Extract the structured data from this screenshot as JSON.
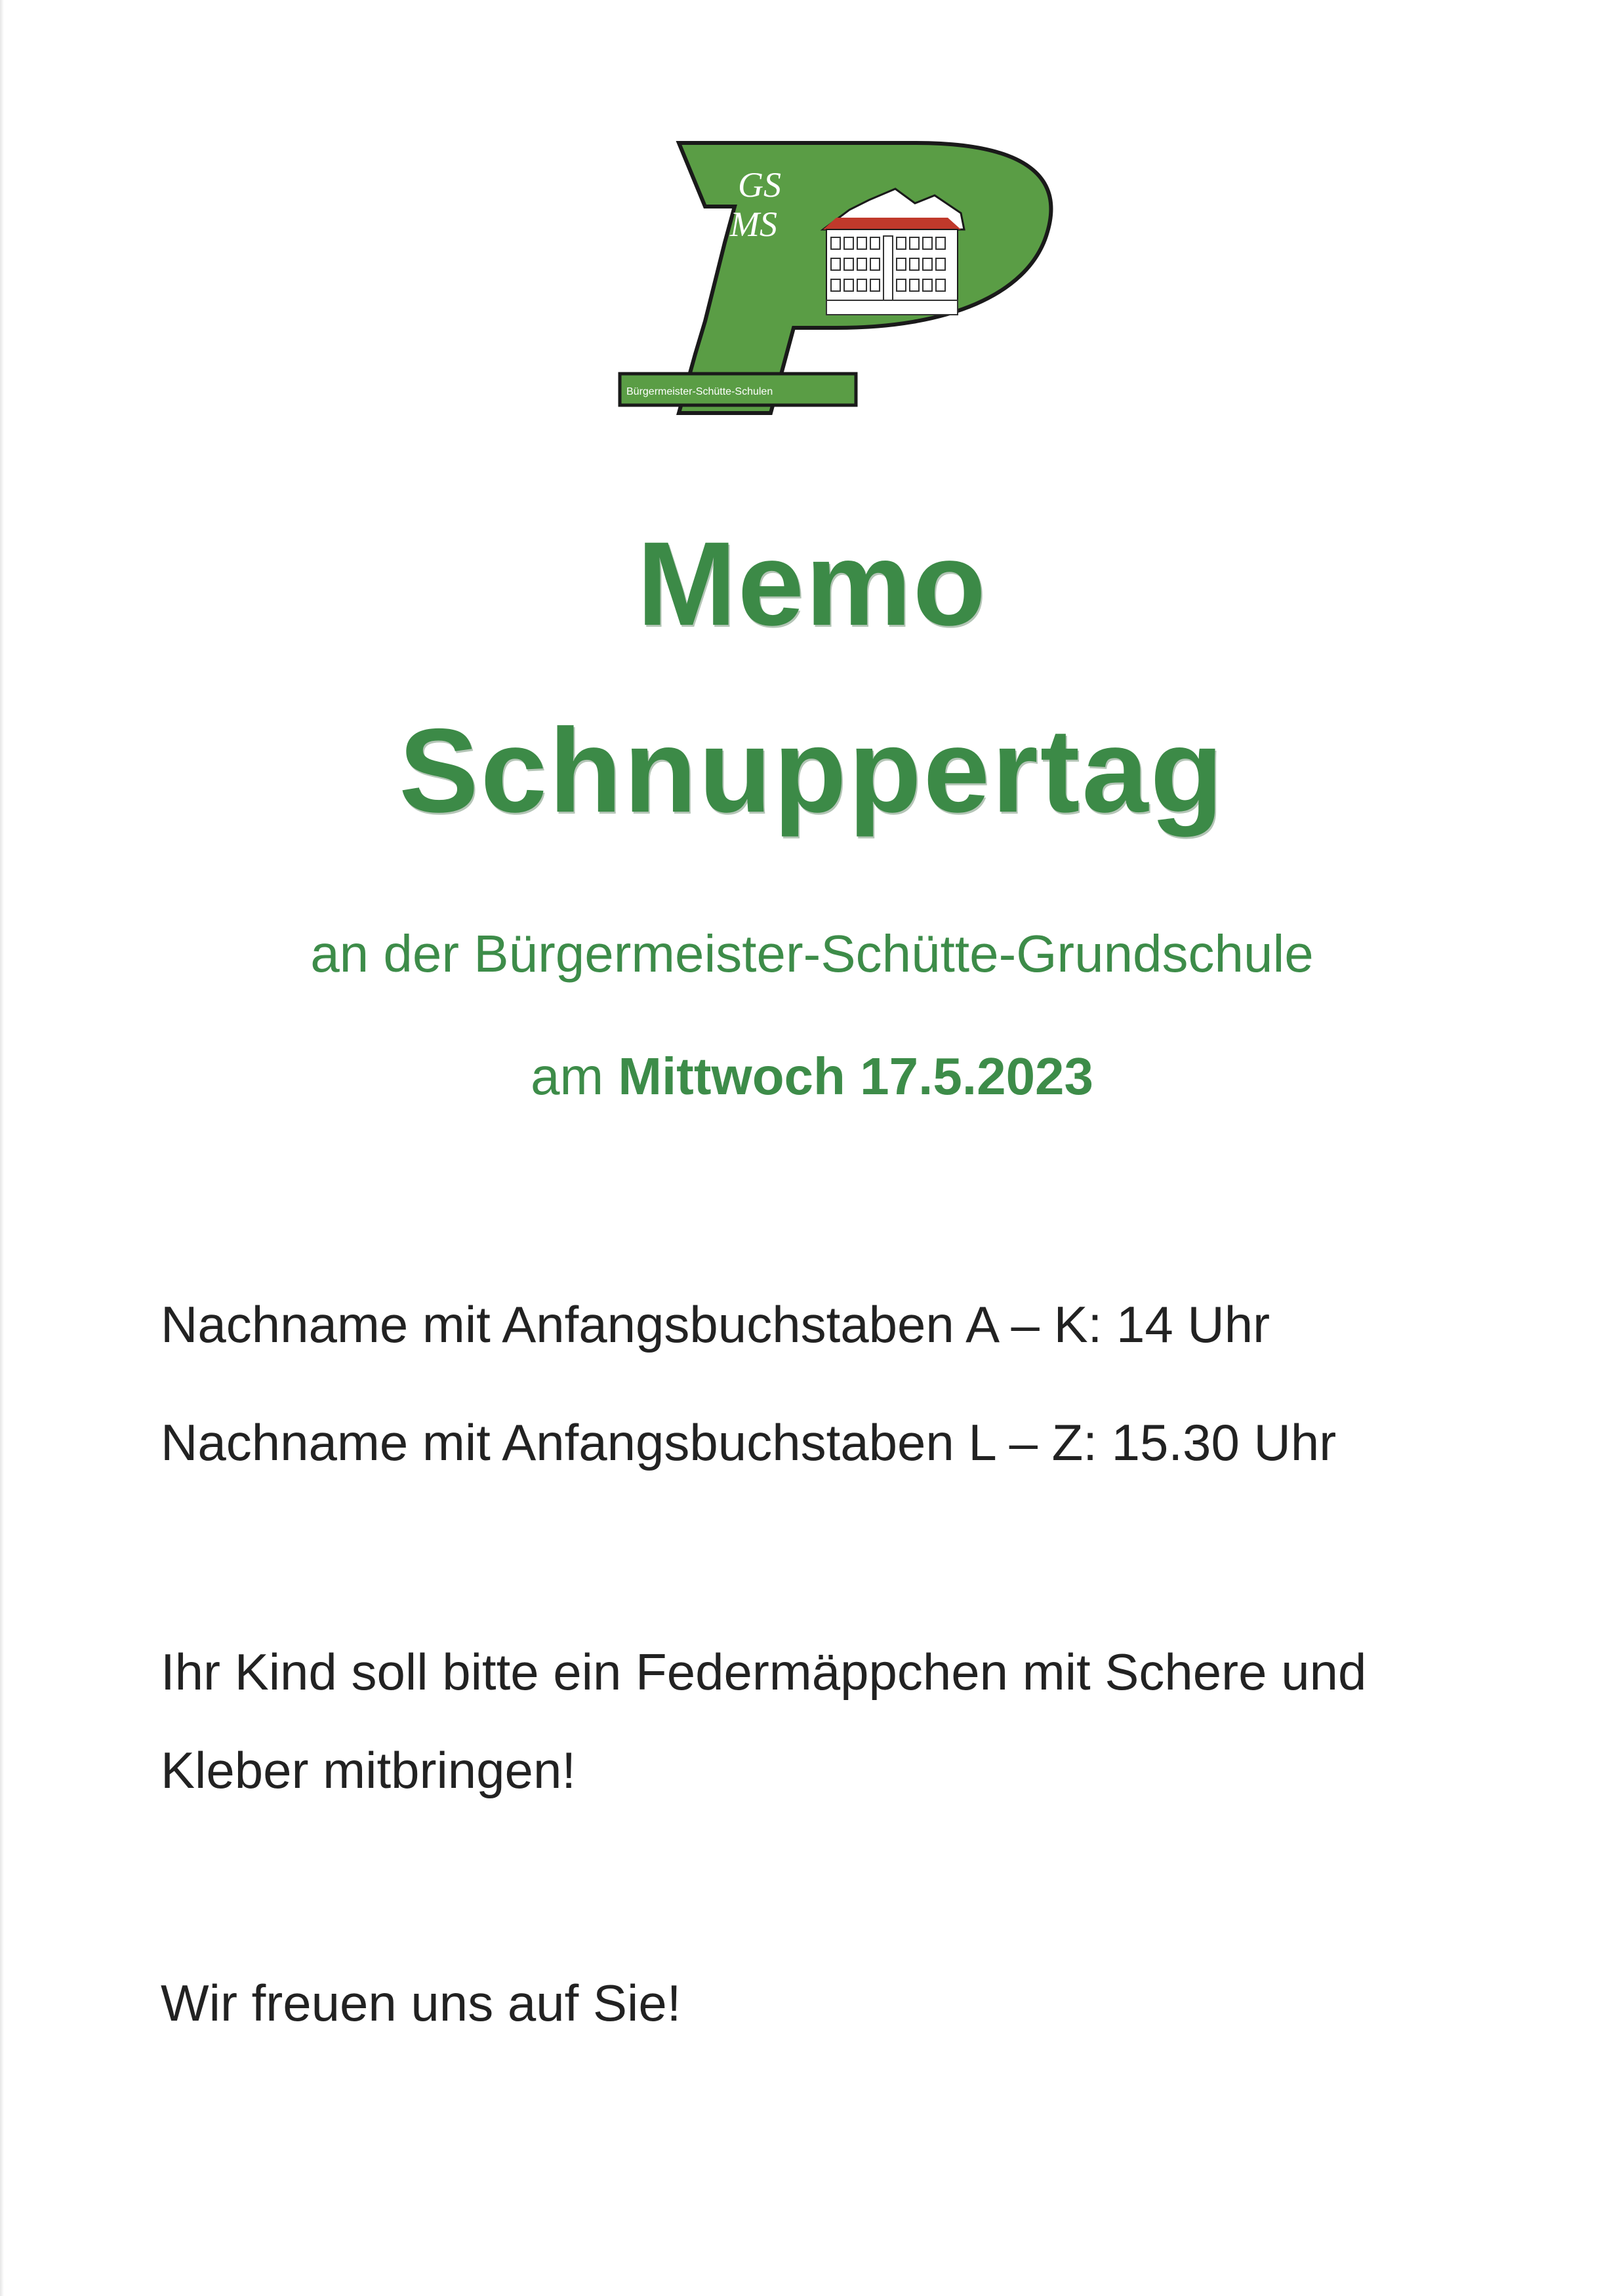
{
  "logo": {
    "text_gs": "GS",
    "text_ms": "MS",
    "school_banner": "Bürgermeister-Schütte-Schulen",
    "colors": {
      "green": "#5a9d45",
      "dark_outline": "#1a1a1a",
      "roof": "#c0392b"
    }
  },
  "heading": {
    "line1": "Memo",
    "line2": "Schnuppertag"
  },
  "subtitle": "an der Bürgermeister-Schütte-Grundschule",
  "date": {
    "prefix": "am ",
    "weekday_date": "Mittwoch 17.5.2023"
  },
  "schedule": [
    "Nachname mit Anfangsbuchstaben A – K: 14 Uhr",
    "Nachname mit Anfangsbuchstaben L – Z: 15.30 Uhr"
  ],
  "instructions": [
    "Ihr Kind soll bitte ein Federmäppchen mit Schere und",
    "Kleber mitbringen!"
  ],
  "closing": "Wir freuen uns auf Sie!",
  "colors": {
    "heading_green": "#3c8a47",
    "text": "#222222"
  }
}
